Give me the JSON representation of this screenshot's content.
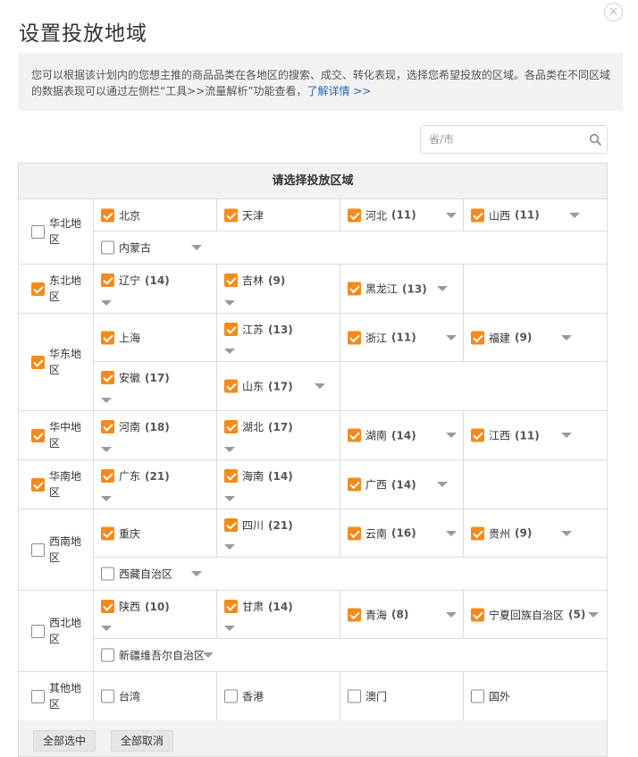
{
  "dialog": {
    "title": "设置投放地域",
    "close_symbol": "×",
    "description": "您可以根据该计划内的您想主推的商品品类在各地区的搜索、成交、转化表现，选择您希望投放的区域。各品类在不同区域的数据表现可以通过左侧栏“工具>>流量解析”功能查看，",
    "detail_link": "了解详情 >>"
  },
  "search": {
    "placeholder": "省/市",
    "value": ""
  },
  "table": {
    "header": "请选择投放区域"
  },
  "regions": [
    {
      "name": "华北地区",
      "checked": false,
      "rows": [
        [
          {
            "name": "北京",
            "count": "",
            "checked": true,
            "dropdown": false
          },
          {
            "name": "天津",
            "count": "",
            "checked": true,
            "dropdown": false
          },
          {
            "name": "河北",
            "count": "(11)",
            "checked": true,
            "dropdown": true
          },
          {
            "name": "山西",
            "count": "(11)",
            "checked": true,
            "dropdown": true
          }
        ],
        [
          {
            "name": "内蒙古",
            "count": "",
            "checked": false,
            "dropdown": true
          }
        ]
      ]
    },
    {
      "name": "东北地区",
      "checked": true,
      "rows": [
        [
          {
            "name": "辽宁",
            "count": "(14)",
            "checked": true,
            "dropdown": true
          },
          {
            "name": "吉林",
            "count": "(9)",
            "checked": true,
            "dropdown": true
          },
          {
            "name": "黑龙江",
            "count": "(13)",
            "checked": true,
            "dropdown": true
          }
        ]
      ]
    },
    {
      "name": "华东地区",
      "checked": true,
      "rows": [
        [
          {
            "name": "上海",
            "count": "",
            "checked": true,
            "dropdown": false
          },
          {
            "name": "江苏",
            "count": "(13)",
            "checked": true,
            "dropdown": true
          },
          {
            "name": "浙江",
            "count": "(11)",
            "checked": true,
            "dropdown": true
          },
          {
            "name": "福建",
            "count": "(9)",
            "checked": true,
            "dropdown": true
          }
        ],
        [
          {
            "name": "安徽",
            "count": "(17)",
            "checked": true,
            "dropdown": true
          },
          {
            "name": "山东",
            "count": "(17)",
            "checked": true,
            "dropdown": true
          }
        ]
      ]
    },
    {
      "name": "华中地区",
      "checked": true,
      "rows": [
        [
          {
            "name": "河南",
            "count": "(18)",
            "checked": true,
            "dropdown": true
          },
          {
            "name": "湖北",
            "count": "(17)",
            "checked": true,
            "dropdown": true
          },
          {
            "name": "湖南",
            "count": "(14)",
            "checked": true,
            "dropdown": true
          },
          {
            "name": "江西",
            "count": "(11)",
            "checked": true,
            "dropdown": true
          }
        ]
      ]
    },
    {
      "name": "华南地区",
      "checked": true,
      "rows": [
        [
          {
            "name": "广东",
            "count": "(21)",
            "checked": true,
            "dropdown": true
          },
          {
            "name": "海南",
            "count": "(14)",
            "checked": true,
            "dropdown": true
          },
          {
            "name": "广西",
            "count": "(14)",
            "checked": true,
            "dropdown": true
          }
        ]
      ]
    },
    {
      "name": "西南地区",
      "checked": false,
      "rows": [
        [
          {
            "name": "重庆",
            "count": "",
            "checked": true,
            "dropdown": false
          },
          {
            "name": "四川",
            "count": "(21)",
            "checked": true,
            "dropdown": true
          },
          {
            "name": "云南",
            "count": "(16)",
            "checked": true,
            "dropdown": true
          },
          {
            "name": "贵州",
            "count": "(9)",
            "checked": true,
            "dropdown": true
          }
        ],
        [
          {
            "name": "西藏自治区",
            "count": "",
            "checked": false,
            "dropdown": true
          }
        ]
      ]
    },
    {
      "name": "西北地区",
      "checked": false,
      "rows": [
        [
          {
            "name": "陕西",
            "count": "(10)",
            "checked": true,
            "dropdown": true
          },
          {
            "name": "甘肃",
            "count": "(14)",
            "checked": true,
            "dropdown": true
          },
          {
            "name": "青海",
            "count": "(8)",
            "checked": true,
            "dropdown": true
          },
          {
            "name": "宁夏回族自治区",
            "count": "(5)",
            "checked": true,
            "dropdown": true
          }
        ],
        [
          {
            "name": "新疆维吾尔自治区",
            "count": "",
            "checked": false,
            "dropdown": true
          }
        ]
      ]
    },
    {
      "name": "其他地区",
      "checked": false,
      "rows": [
        [
          {
            "name": "台湾",
            "count": "",
            "checked": false,
            "dropdown": false
          },
          {
            "name": "香港",
            "count": "",
            "checked": false,
            "dropdown": false
          },
          {
            "name": "澳门",
            "count": "",
            "checked": false,
            "dropdown": false
          },
          {
            "name": "国外",
            "count": "",
            "checked": false,
            "dropdown": false
          }
        ]
      ]
    }
  ],
  "footer": {
    "select_all": "全部选中",
    "deselect_all": "全部取消"
  },
  "colors": {
    "accent": "#f48a1a",
    "link": "#1e6bc4",
    "panel_bg": "#f2f2f2",
    "border": "#dcdcdc"
  }
}
